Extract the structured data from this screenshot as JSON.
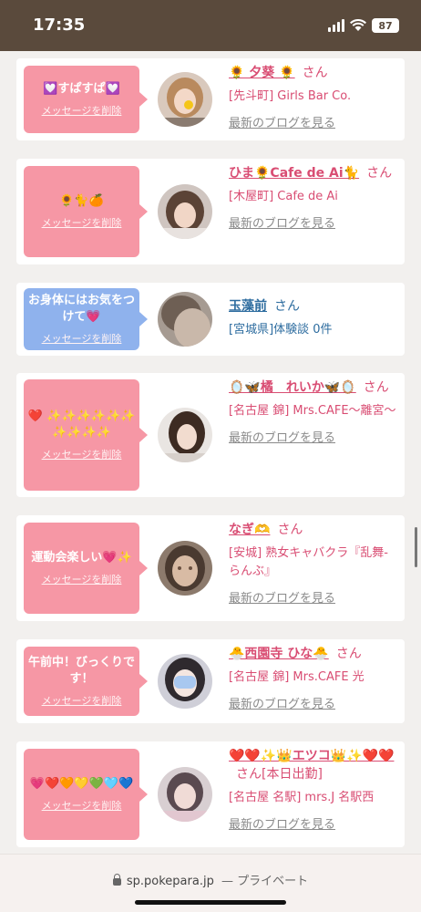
{
  "status": {
    "time": "17:35",
    "battery": "87"
  },
  "cards": [
    {
      "bubble_text": "💟すぱすぱ💟",
      "bubble_delete": "メッセージを削除",
      "bubble_color": "pink",
      "name": "🌻 夕葵 🌻",
      "san": "さん",
      "shop": "[先斗町] Girls Bar Co.",
      "blog": "最新のブログを見る"
    },
    {
      "bubble_text": "🌻🐈🍊",
      "bubble_delete": "メッセージを削除",
      "bubble_color": "pink",
      "name": "ひま🌻Cafe de Ai🐈",
      "san": "さん",
      "shop": "[木屋町] Cafe de Ai",
      "blog": "最新のブログを見る"
    },
    {
      "bubble_text": "お身体にはお気をつけて💗",
      "bubble_delete": "メッセージを削除",
      "bubble_color": "blue",
      "name": "玉藻前",
      "san": "さん",
      "shop": "[宮城県]体験談 0件",
      "blog": ""
    },
    {
      "bubble_text": "❤️ ✨✨✨✨✨✨ ✨✨✨✨",
      "bubble_delete": "メッセージを削除",
      "bubble_color": "pink",
      "name": "🪞🦋橘　れいか🦋🪞",
      "san": "さん",
      "shop": "[名古屋 錦] Mrs.CAFE〜離宮〜",
      "blog": "最新のブログを見る"
    },
    {
      "bubble_text": "運動会楽しい💗✨",
      "bubble_delete": "メッセージを削除",
      "bubble_color": "pink",
      "name": "なぎ🫶",
      "san": "さん",
      "shop": "[安城] 熟女キャバクラ『乱舞-らんぶ』",
      "blog": "最新のブログを見る"
    },
    {
      "bubble_text": "午前中！びっくりです！",
      "bubble_delete": "メッセージを削除",
      "bubble_color": "pink",
      "name": "🐣西園寺 ひな🐣",
      "san": "さん",
      "shop": "[名古屋 錦] Mrs.CAFE 光",
      "blog": "最新のブログを見る"
    },
    {
      "bubble_text": "💗❤️🧡💛💚🩵💙",
      "bubble_delete": "メッセージを削除",
      "bubble_color": "pink",
      "name": "❤️❤️✨👑エツコ👑✨❤️❤️",
      "san": "さん[本日出勤]",
      "shop": "[名古屋 名駅] mrs.J 名駅西",
      "blog": "最新のブログを見る"
    }
  ],
  "url_bar": {
    "domain": "sp.pokepara.jp",
    "privacy": "— プライベート"
  }
}
